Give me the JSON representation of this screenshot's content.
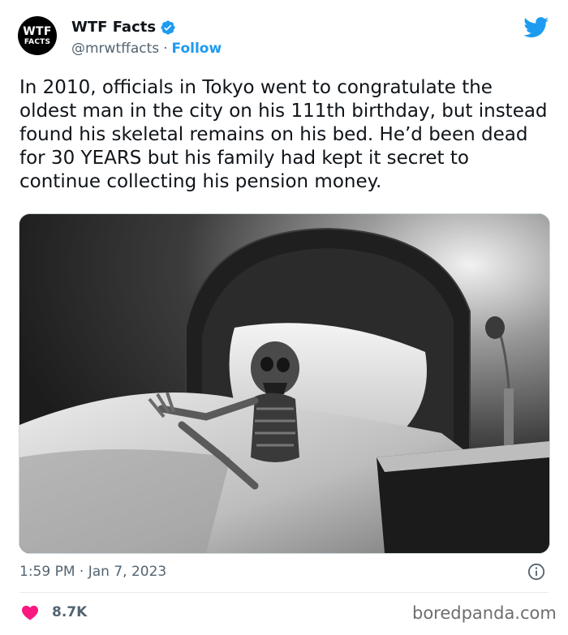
{
  "tweet": {
    "avatar_line1": "WTF",
    "avatar_line2": "FACTS",
    "display_name": "WTF Facts",
    "handle": "@mrwtffacts",
    "separator": "·",
    "follow_label": "Follow",
    "text": "In 2010, officials in Tokyo went to congratulate the oldest man in the city on his 111th birthday, but instead found his skeletal remains on his bed. He’d been dead for 30 YEARS but his family had kept it secret to continue collecting his pension money.",
    "timestamp": "1:59 PM · Jan 7, 2023",
    "like_count": "8.7K"
  },
  "watermark": "boredpanda.com",
  "colors": {
    "accent_blue": "#1d9bf0",
    "like_red": "#f91880",
    "secondary_text": "#536471"
  },
  "icons": {
    "verified": "verified-badge-icon",
    "platform": "twitter-bird-icon",
    "info": "info-icon",
    "like": "heart-icon"
  }
}
